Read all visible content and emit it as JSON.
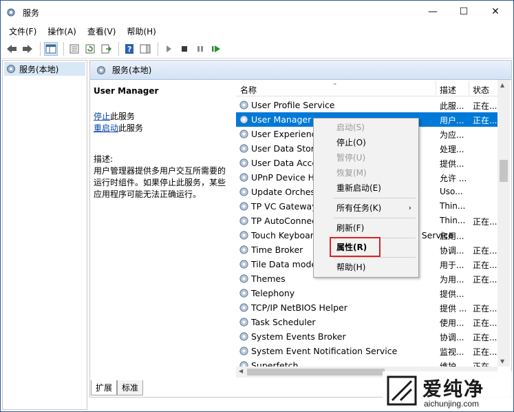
{
  "window": {
    "title": "服务"
  },
  "menu": [
    "文件(F)",
    "操作(A)",
    "查看(V)",
    "帮助(H)"
  ],
  "tree": {
    "root": "服务(本地)"
  },
  "pane": {
    "header": "服务(本地)"
  },
  "details": {
    "service_name": "User Manager",
    "stop_link": "停止",
    "stop_suffix": "此服务",
    "restart_link": "重启动",
    "restart_suffix": "此服务",
    "desc_label": "描述:",
    "desc_lines": [
      "用户管理器提供多用户交互所需要的",
      "运行时组件。如果停止此服务，某些",
      "应用程序可能无法正确运行。"
    ]
  },
  "columns": {
    "name": "名称",
    "desc": "描述",
    "status": "状态"
  },
  "rows": [
    {
      "name": "User Profile Service",
      "desc": "此服...",
      "status": "正在..."
    },
    {
      "name": "User Manager",
      "desc": "用户...",
      "status": "正在...",
      "selected": true
    },
    {
      "name": "User Experience Virtualization Service",
      "desc": "为应...",
      "status": ""
    },
    {
      "name": "User Data Storage",
      "desc": "处理...",
      "status": ""
    },
    {
      "name": "User Data Access",
      "desc": "提供...",
      "status": ""
    },
    {
      "name": "UPnP Device Host",
      "desc": "允许 ...",
      "status": ""
    },
    {
      "name": "Update Orchestrator Service",
      "desc": "Uso...",
      "status": ""
    },
    {
      "name": "TP VC Gateway Service",
      "desc": "Thin...",
      "status": ""
    },
    {
      "name": "TP AutoConnect Service",
      "desc": "Thin...",
      "status": "正在..."
    },
    {
      "name": "Touch Keyboard and Handwriting Panel Service",
      "desc": "启用...",
      "status": ""
    },
    {
      "name": "Time Broker",
      "desc": "协调...",
      "status": "正在..."
    },
    {
      "name": "Tile Data model server",
      "desc": "用于...",
      "status": "正在..."
    },
    {
      "name": "Themes",
      "desc": "为用...",
      "status": "正在..."
    },
    {
      "name": "Telephony",
      "desc": "提供...",
      "status": ""
    },
    {
      "name": "TCP/IP NetBIOS Helper",
      "desc": "提供 ...",
      "status": "正在..."
    },
    {
      "name": "Task Scheduler",
      "desc": "使用...",
      "status": "正在..."
    },
    {
      "name": "System Events Broker",
      "desc": "协调...",
      "status": "正在..."
    },
    {
      "name": "System Event Notification Service",
      "desc": "监视...",
      "status": "正在..."
    },
    {
      "name": "Superfetch",
      "desc": "维护...",
      "status": "正在..."
    }
  ],
  "context_menu": [
    {
      "label": "启动(S)",
      "disabled": true
    },
    {
      "label": "停止(O)",
      "disabled": false
    },
    {
      "label": "暂停(U)",
      "disabled": true
    },
    {
      "label": "恢复(M)",
      "disabled": true
    },
    {
      "label": "重新启动(E)",
      "disabled": false
    },
    {
      "label": "所有任务(K)",
      "disabled": false,
      "submenu": true
    },
    {
      "label": "刷新(F)",
      "disabled": false
    },
    {
      "label": "属性(R)",
      "disabled": false,
      "bold": true
    },
    {
      "label": "帮助(H)",
      "disabled": false
    }
  ],
  "tabs": [
    "扩展",
    "标准"
  ],
  "watermark": {
    "brand": "爱纯净",
    "url": "aichunjing.com"
  },
  "colors": {
    "selection": "#0078d7",
    "highlight_box": "#e02020",
    "link": "#0645ad"
  }
}
